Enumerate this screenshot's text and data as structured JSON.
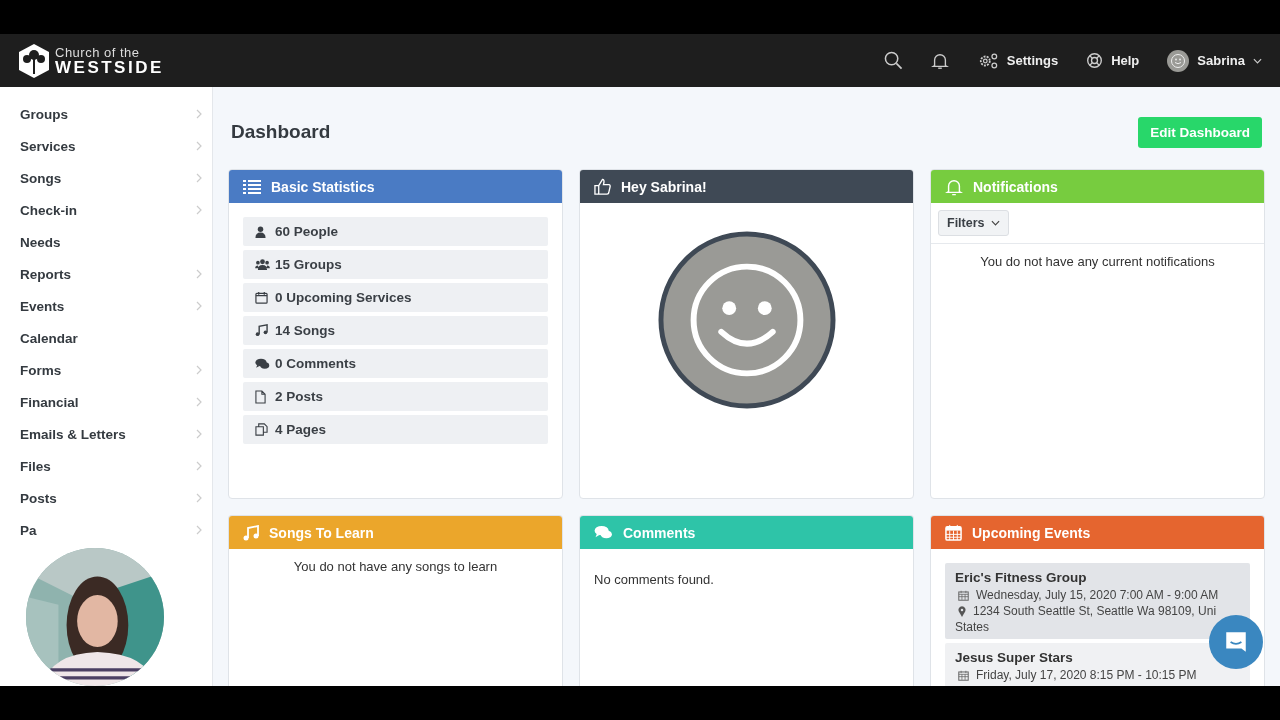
{
  "header": {
    "logo_line1": "Church of the",
    "logo_line2": "WESTSIDE",
    "settings": "Settings",
    "help": "Help",
    "user": "Sabrina"
  },
  "sidebar": {
    "items": [
      {
        "label": "Groups",
        "has_submenu": true
      },
      {
        "label": "Services",
        "has_submenu": true
      },
      {
        "label": "Songs",
        "has_submenu": true
      },
      {
        "label": "Check-in",
        "has_submenu": true
      },
      {
        "label": "Needs",
        "has_submenu": false
      },
      {
        "label": "Reports",
        "has_submenu": true
      },
      {
        "label": "Events",
        "has_submenu": true
      },
      {
        "label": "Calendar",
        "has_submenu": false
      },
      {
        "label": "Forms",
        "has_submenu": true
      },
      {
        "label": "Financial",
        "has_submenu": true
      },
      {
        "label": "Emails & Letters",
        "has_submenu": true
      },
      {
        "label": "Files",
        "has_submenu": true
      },
      {
        "label": "Posts",
        "has_submenu": true
      },
      {
        "label": "Pa",
        "has_submenu": true
      }
    ]
  },
  "page": {
    "title": "Dashboard",
    "edit_button": "Edit Dashboard"
  },
  "cards": [
    {
      "kind": "stats",
      "title": "Basic Statistics",
      "color": "#4a7bc4",
      "items": [
        {
          "kind": "person",
          "label": "60 People"
        },
        {
          "kind": "group",
          "label": "15 Groups"
        },
        {
          "kind": "calendar",
          "label": "0 Upcoming Services"
        },
        {
          "kind": "music",
          "label": "14 Songs"
        },
        {
          "kind": "comments",
          "label": "0 Comments"
        },
        {
          "kind": "file",
          "label": "2 Posts"
        },
        {
          "kind": "pages",
          "label": "4 Pages"
        }
      ]
    },
    {
      "kind": "welcome",
      "title": "Hey Sabrina!",
      "color": "#3f4955"
    },
    {
      "kind": "notifications",
      "title": "Notifications",
      "color": "#77cc3f",
      "filter": "Filters",
      "empty": "You do not have any current notifications"
    },
    {
      "kind": "songs",
      "title": "Songs To Learn",
      "color": "#eba62b",
      "empty": "You do not have any songs to learn"
    },
    {
      "kind": "comments",
      "title": "Comments",
      "color": "#2ec4a8",
      "empty": "No comments found."
    },
    {
      "kind": "events",
      "title": "Upcoming Events",
      "color": "#e5652f",
      "events": [
        {
          "name": "Eric's Fitness Group",
          "date": "Wednesday, July 15, 2020 7:00 AM - 9:00 AM",
          "location": "1234 South Seattle St, Seattle Wa 98109, Uni",
          "location_cont": "States"
        },
        {
          "name": "Jesus Super Stars",
          "date": "Friday, July 17, 2020 8:15 PM - 10:15 PM"
        }
      ]
    }
  ]
}
